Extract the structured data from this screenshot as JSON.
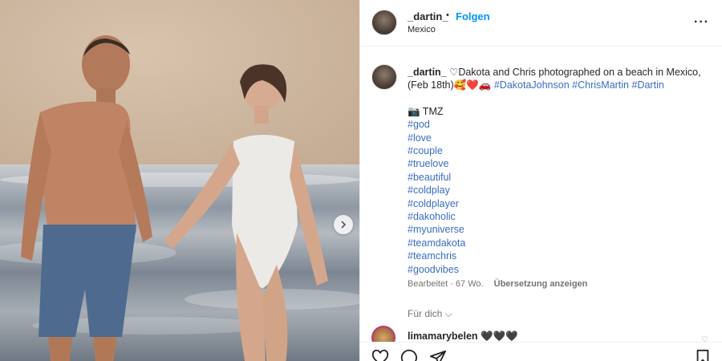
{
  "post": {
    "author": "_dartin_",
    "follow_label": "Folgen",
    "separator": "•",
    "location": "Mexico",
    "more_label": "···"
  },
  "caption": {
    "username": "_dartin_",
    "text": "♡Dakota and Chris photographed on a beach in Mexico, (Feb 18th)🥰❤️🚗",
    "inline_tags": [
      "#DakotaJohnson",
      "#ChrisMartin",
      "#Dartin"
    ],
    "credit": "📷 TMZ",
    "tags": [
      "#god",
      "#love",
      "#couple",
      "#truelove",
      "#beautiful",
      "#coldplay",
      "#coldplayer",
      "#dakoholic",
      "#myuniverse",
      "#teamdakota",
      "#teamchris",
      "#goodvibes"
    ]
  },
  "meta": {
    "edited": "Bearbeitet · 67 Wo.",
    "translate": "Übersetzung anzeigen"
  },
  "for_you": "Für dich ⌵",
  "comment": {
    "username": "limamarybelen 🖤🖤🖤"
  },
  "colors": {
    "link": "#3b6cc4",
    "follow": "#0095f6",
    "muted": "#737373"
  },
  "icons": [
    "heart-icon",
    "comment-icon",
    "share-icon",
    "bookmark-icon",
    "chevron-right-icon",
    "more-icon"
  ]
}
